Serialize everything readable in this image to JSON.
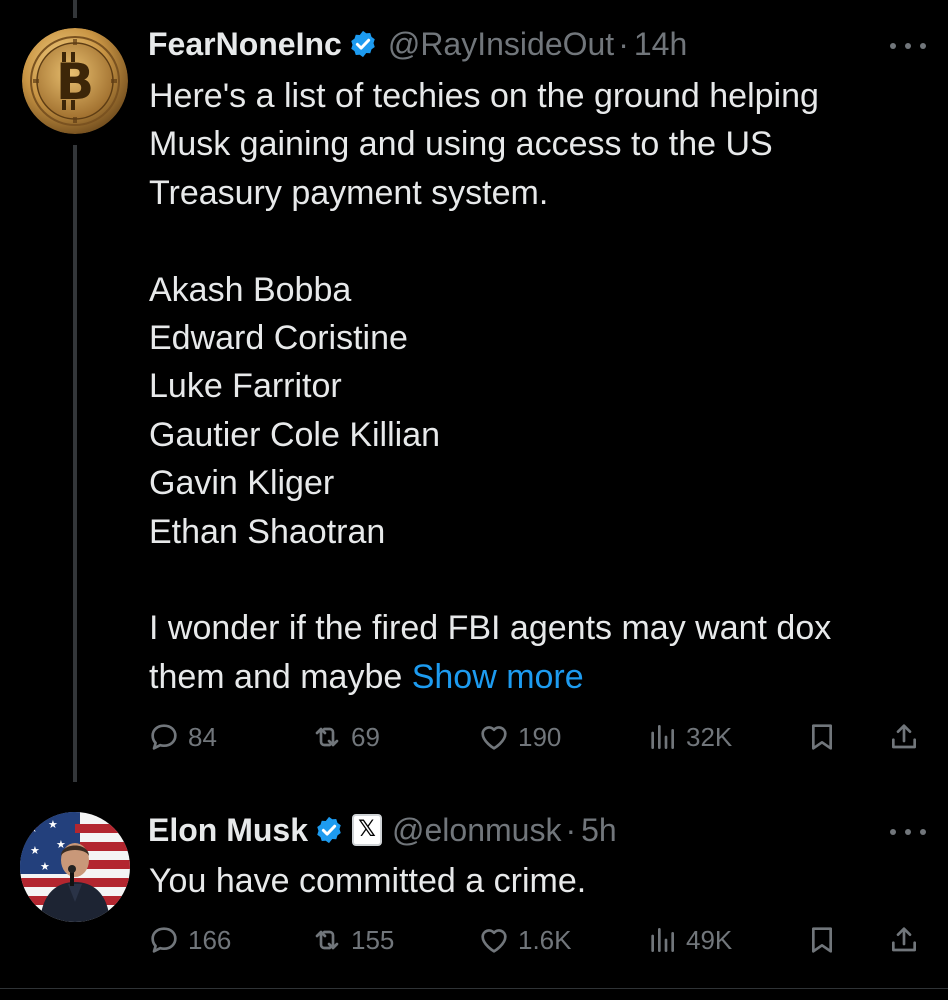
{
  "tweets": [
    {
      "display_name": "FearNoneInc",
      "handle": "@RayInsideOut",
      "separator": "·",
      "time": "14h",
      "avatar_icon": "bitcoin-coin-icon",
      "text_lines": [
        "Here's a list of techies on the ground helping",
        "Musk gaining and using access to the US",
        "Treasury payment system.",
        "",
        "Akash Bobba",
        "Edward Coristine",
        "Luke Farritor",
        "Gautier Cole Killian",
        "Gavin Kliger",
        "Ethan Shaotran",
        "",
        "I wonder if the fired FBI agents may want dox"
      ],
      "last_line": "them and maybe ",
      "show_more": "Show more",
      "replies": "84",
      "reposts": "69",
      "likes": "190",
      "views": "32K"
    },
    {
      "display_name": "Elon Musk",
      "handle": "@elonmusk",
      "separator": "·",
      "time": "5h",
      "affiliate_badge": "𝕏",
      "avatar_icon": "elon-musk-photo-avatar",
      "text": "You have committed a crime.",
      "replies": "166",
      "reposts": "155",
      "likes": "1.6K",
      "views": "49K"
    }
  ],
  "colors": {
    "background": "#000000",
    "text": "#e7e9ea",
    "secondary": "#71767b",
    "accent": "#1d9bf0",
    "thread_line": "#333639"
  }
}
